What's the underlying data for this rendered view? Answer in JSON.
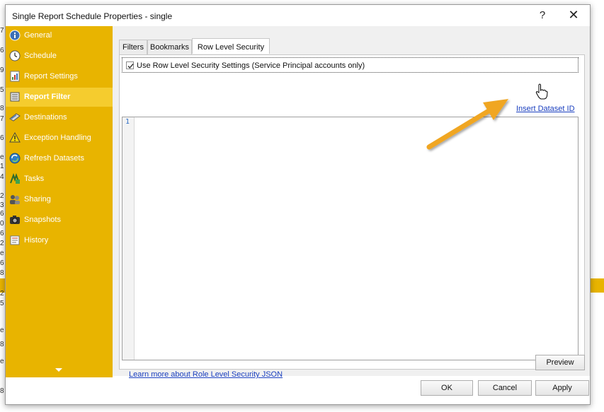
{
  "dialog": {
    "title": "Single Report Schedule Properties - single",
    "help_label": "?",
    "close_label": "✕"
  },
  "sidebar": {
    "items": [
      {
        "label": "General",
        "icon": "info-icon"
      },
      {
        "label": "Schedule",
        "icon": "clock-icon"
      },
      {
        "label": "Report Settings",
        "icon": "report-settings-icon"
      },
      {
        "label": "Report Filter",
        "icon": "filter-icon",
        "active": true
      },
      {
        "label": "Destinations",
        "icon": "destination-icon"
      },
      {
        "label": "Exception Handling",
        "icon": "warning-icon"
      },
      {
        "label": "Refresh Datasets",
        "icon": "refresh-icon"
      },
      {
        "label": "Tasks",
        "icon": "tasks-icon"
      },
      {
        "label": "Sharing",
        "icon": "sharing-icon"
      },
      {
        "label": "Snapshots",
        "icon": "camera-icon"
      },
      {
        "label": "History",
        "icon": "history-icon"
      }
    ]
  },
  "tabs": [
    {
      "label": "Filters"
    },
    {
      "label": "Bookmarks"
    },
    {
      "label": "Row Level Security",
      "active": true
    }
  ],
  "rls": {
    "checkbox_label": "Use Row Level Security Settings (Service Principal accounts only)",
    "checked": true,
    "insert_link": "Insert Dataset ID",
    "line_number": "1",
    "learn_link": "Learn more about Role Level Security JSON"
  },
  "buttons": {
    "preview": "Preview",
    "ok": "OK",
    "cancel": "Cancel",
    "apply": "Apply"
  },
  "background_digits": [
    "7",
    "6",
    "9",
    "5",
    "8",
    "7",
    "6",
    "e",
    "1",
    "4",
    "2",
    "3",
    "6",
    "0",
    "6",
    "2",
    "e",
    "6",
    "8",
    "2",
    "5",
    "e",
    "8",
    "e",
    "8"
  ],
  "colors": {
    "sidebar": "#e8b400",
    "sidebar_active": "#f5cc2e",
    "link": "#1a3fbf",
    "arrow": "#f0a623"
  }
}
